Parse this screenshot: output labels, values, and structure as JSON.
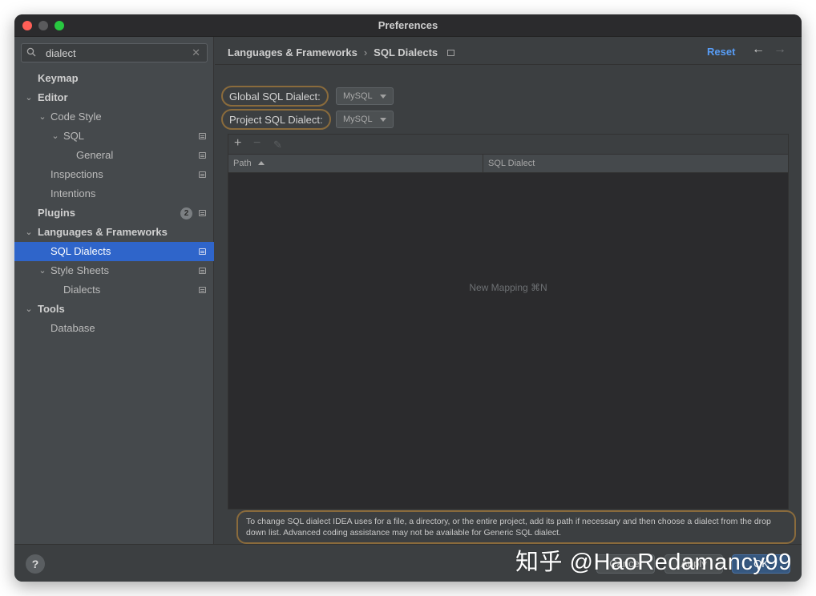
{
  "window": {
    "title": "Preferences"
  },
  "search": {
    "value": "dialect",
    "placeholder": ""
  },
  "sidebar": {
    "items": [
      {
        "label": "Keymap"
      },
      {
        "label": "Editor"
      },
      {
        "label": "Code Style"
      },
      {
        "label": "SQL"
      },
      {
        "label": "General"
      },
      {
        "label": "Inspections"
      },
      {
        "label": "Intentions"
      },
      {
        "label": "Plugins",
        "badge": "2"
      },
      {
        "label": "Languages & Frameworks"
      },
      {
        "label": "SQL Dialects"
      },
      {
        "label": "Style Sheets"
      },
      {
        "label": "Dialects"
      },
      {
        "label": "Tools"
      },
      {
        "label": "Database"
      }
    ]
  },
  "header": {
    "breadcrumb": [
      "Languages & Frameworks",
      "SQL Dialects"
    ],
    "reset_label": "Reset"
  },
  "form": {
    "global_label": "Global SQL Dialect:",
    "global_value": "MySQL",
    "project_label": "Project SQL Dialect:",
    "project_value": "MySQL"
  },
  "table": {
    "columns": [
      "Path",
      "SQL Dialect"
    ],
    "empty_text": "New Mapping ⌘N"
  },
  "hint": "To change SQL dialect IDEA uses for a file, a directory, or the entire project, add its path if necessary and then choose a dialect from the drop down list. Advanced coding assistance may not be available for Generic SQL dialect.",
  "footer": {
    "help": "?",
    "cancel_label": "Cancel",
    "apply_label": "Apply",
    "ok_label": "OK"
  },
  "watermark": "知乎 @HaoRedamancy99",
  "colors": {
    "selection": "#2f65ca",
    "link": "#589df6",
    "highlight_ring": "#8a6b3c"
  }
}
